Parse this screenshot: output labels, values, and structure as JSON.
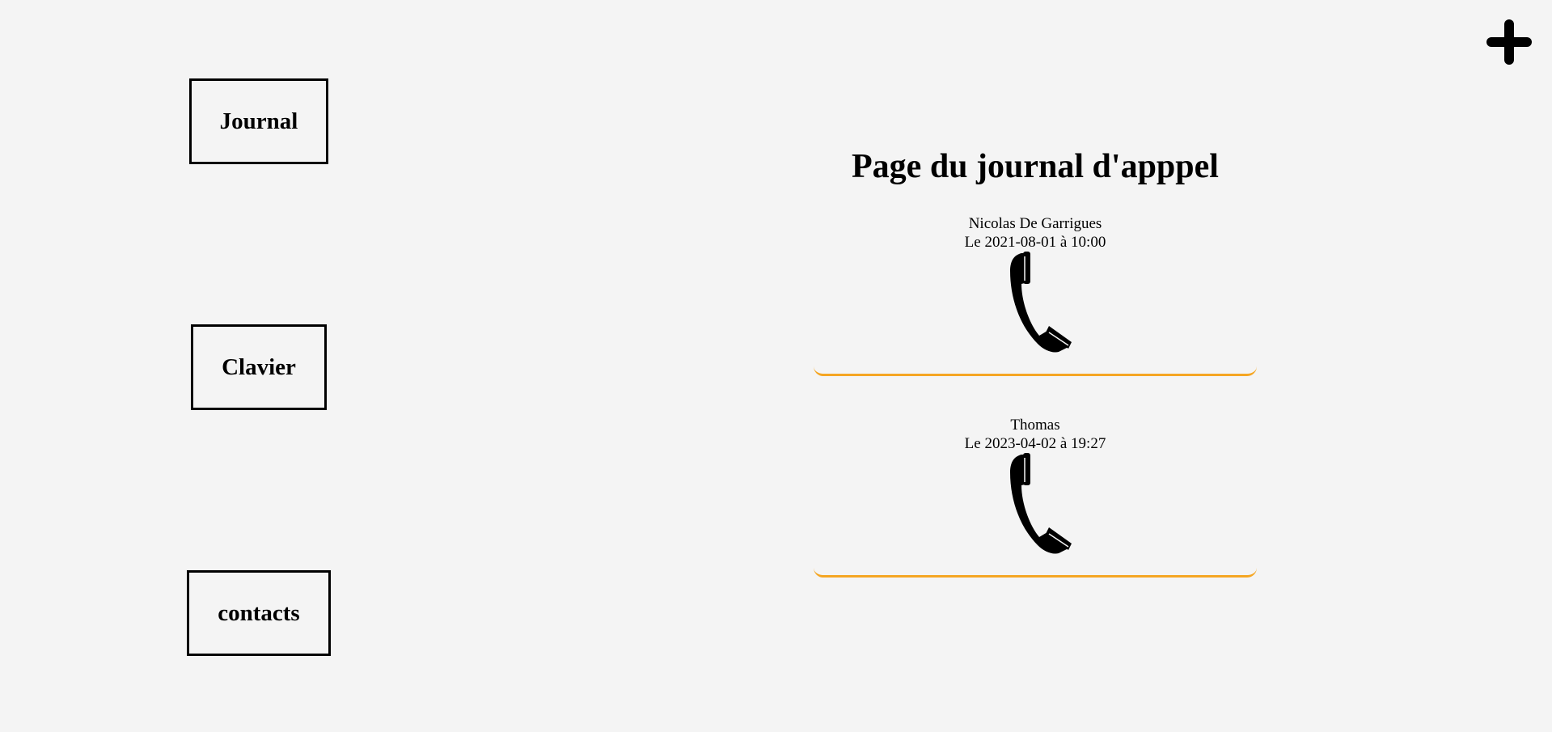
{
  "nav": {
    "journal_label": "Journal",
    "clavier_label": "Clavier",
    "contacts_label": "contacts"
  },
  "add_button_icon": "plus-icon",
  "page_title": "Page du journal d'apppel",
  "accent_color": "#f5a623",
  "calls": [
    {
      "name": "Nicolas De Garrigues",
      "date": "Le 2021-08-01 à 10:00",
      "icon": "phone-icon"
    },
    {
      "name": "Thomas",
      "date": "Le 2023-04-02 à 19:27",
      "icon": "phone-icon"
    }
  ]
}
